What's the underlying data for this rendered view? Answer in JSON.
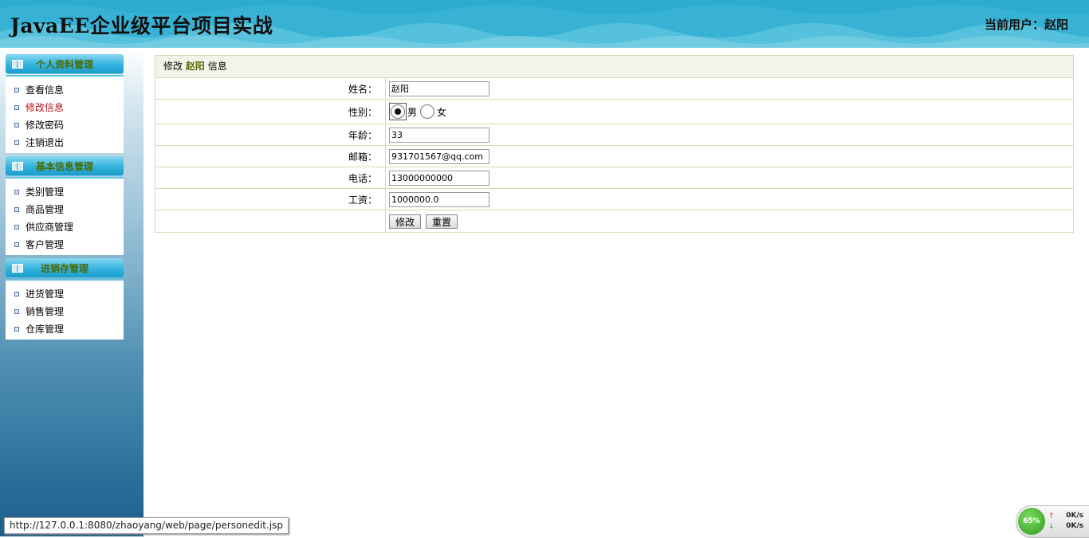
{
  "header": {
    "app_title": "JavaEE企业级平台项目实战",
    "current_user": "当前用户：赵阳"
  },
  "sidebar": {
    "groups": [
      {
        "title": "个人资料管理",
        "items": [
          {
            "label": "查看信息",
            "active": false
          },
          {
            "label": "修改信息",
            "active": true
          },
          {
            "label": "修改密码",
            "active": false
          },
          {
            "label": "注销退出",
            "active": false
          }
        ]
      },
      {
        "title": "基本信息管理",
        "items": [
          {
            "label": "类别管理"
          },
          {
            "label": "商品管理"
          },
          {
            "label": "供应商管理"
          },
          {
            "label": "客户管理"
          }
        ]
      },
      {
        "title": "进销存管理",
        "items": [
          {
            "label": "进货管理"
          },
          {
            "label": "销售管理"
          },
          {
            "label": "仓库管理"
          }
        ]
      }
    ]
  },
  "form": {
    "heading_prefix": "修改",
    "heading_user": "赵阳",
    "heading_suffix": "信息",
    "name_label": "姓名：",
    "name_value": "赵阳",
    "gender_label": "性别：",
    "gender_male": "男",
    "gender_female": "女",
    "gender_selected": "男",
    "age_label": "年龄：",
    "age_value": "33",
    "email_label": "邮箱：",
    "email_value": "931701567@qq.com",
    "phone_label": "电话：",
    "phone_value": "13000000000",
    "salary_label": "工资：",
    "salary_value": "1000000.0",
    "submit_label": "修改",
    "reset_label": "重置"
  },
  "statusbar": {
    "url": "http://127.0.0.1:8080/zhaoyang/web/page/personedit.jsp"
  },
  "netmon": {
    "percent": "65%",
    "up": "0K/s",
    "down": "0K/s"
  },
  "colors": {
    "header_bg": "#37b2d4",
    "menu_title": "#4a6b07",
    "active_item": "#b3141b",
    "table_border": "#d6dbb6"
  }
}
